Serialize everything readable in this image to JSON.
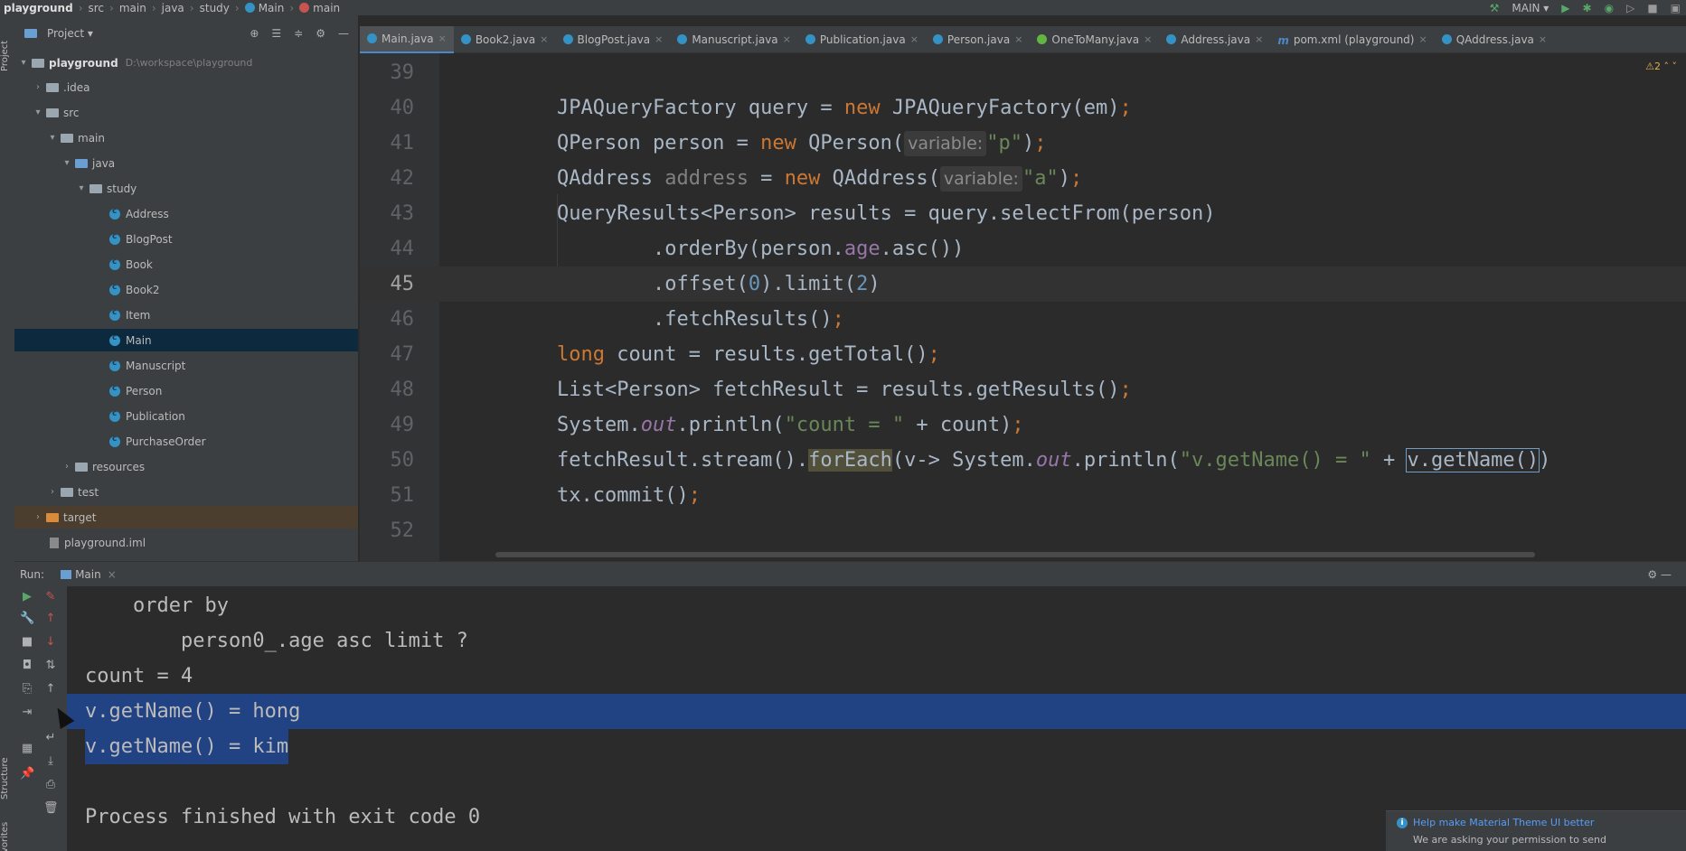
{
  "breadcrumb": [
    "playground",
    "src",
    "main",
    "java",
    "study",
    "Main",
    "main"
  ],
  "toolbar": {
    "run_config": "MAIN"
  },
  "left_strip": {
    "project_tab": "Project",
    "structure_tab": "Structure",
    "favorites_tab": "Favorites"
  },
  "project": {
    "title": "Project",
    "root": {
      "label": "playground",
      "path": "D:\\workspace\\playground"
    },
    "items": [
      {
        "label": ".idea"
      },
      {
        "label": "src"
      },
      {
        "label": "main"
      },
      {
        "label": "java"
      },
      {
        "label": "study"
      },
      {
        "label": "Address"
      },
      {
        "label": "BlogPost"
      },
      {
        "label": "Book"
      },
      {
        "label": "Book2"
      },
      {
        "label": "Item"
      },
      {
        "label": "Main"
      },
      {
        "label": "Manuscript"
      },
      {
        "label": "Person"
      },
      {
        "label": "Publication"
      },
      {
        "label": "PurchaseOrder"
      },
      {
        "label": "resources"
      },
      {
        "label": "test"
      },
      {
        "label": "target"
      },
      {
        "label": "playground.iml"
      }
    ]
  },
  "tabs": [
    {
      "label": "Main.java"
    },
    {
      "label": "Book2.java"
    },
    {
      "label": "BlogPost.java"
    },
    {
      "label": "Manuscript.java"
    },
    {
      "label": "Publication.java"
    },
    {
      "label": "Person.java"
    },
    {
      "label": "OneToMany.java"
    },
    {
      "label": "Address.java"
    },
    {
      "label": "pom.xml (playground)"
    },
    {
      "label": "QAddress.java"
    }
  ],
  "editor": {
    "warning_count": "2",
    "line_numbers": [
      "39",
      "40",
      "41",
      "42",
      "43",
      "44",
      "45",
      "46",
      "47",
      "48",
      "49",
      "50",
      "51",
      "52"
    ],
    "current_line": "45",
    "hint_label": "variable:"
  },
  "run": {
    "label": "Run:",
    "tab": "Main",
    "console": [
      "    order by",
      "        person0_.age asc limit ?",
      "count = 4",
      "v.getName() = hong",
      "v.getName() = kim",
      "",
      "Process finished with exit code 0"
    ]
  },
  "notification": {
    "title": "Help make Material Theme UI better",
    "body": "We are asking your permission to send"
  }
}
